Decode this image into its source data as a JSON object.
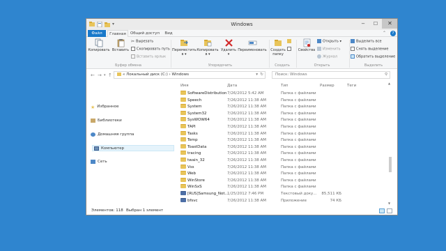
{
  "window": {
    "title": "Windows"
  },
  "window_buttons": {
    "minimize": "‒",
    "maximize": "☐",
    "close": "✕"
  },
  "tabs": [
    {
      "label": "Файл"
    },
    {
      "label": "Главная"
    },
    {
      "label": "Общий доступ"
    },
    {
      "label": "Вид"
    }
  ],
  "ribbon": {
    "clipboard": {
      "copy": "Копировать",
      "paste": "Вставить",
      "cut": "Вырезать",
      "copy_path": "Скопировать путь",
      "paste_shortcut": "Вставить ярлык",
      "label": "Буфер обмена"
    },
    "organize": {
      "move_to": "Переместить в ▾",
      "copy_to": "Копировать в ▾",
      "delete": "Удалить ▾",
      "rename": "Переименовать",
      "label": "Упорядочить"
    },
    "new": {
      "new_folder": "Создать папку",
      "label": "Создать"
    },
    "open": {
      "properties": "Свойства",
      "open": "Открыть ▾",
      "edit": "Изменить",
      "history": "Журнал",
      "label": "Открыть"
    },
    "select": {
      "select_all": "Выделить все",
      "select_none": "Снять выделение",
      "invert": "Обратить выделение",
      "label": "Выделить"
    }
  },
  "address": {
    "back": "←",
    "forward": "→",
    "up": "↑",
    "path": "«  Локальный диск (C:)  ›  Windows",
    "search_placeholder": "Поиск: Windows"
  },
  "nav": [
    {
      "label": "Избранное",
      "icon": "star-icon"
    },
    {
      "label": "Библиотеки",
      "icon": "library-icon"
    },
    {
      "label": "Домашняя группа",
      "icon": "homegroup-icon"
    },
    {
      "label": "Компьютер",
      "icon": "computer-icon"
    },
    {
      "label": "Сеть",
      "icon": "network-icon"
    }
  ],
  "columns": {
    "name": "Имя",
    "date": "Дата",
    "type": "Тип",
    "size": "Размер",
    "tags": "Теги"
  },
  "files": [
    {
      "name": "SoftwareDistribution",
      "date": "7/26/2012 5:42 AM",
      "type": "Папка с файлами",
      "size": "",
      "icon": "folder"
    },
    {
      "name": "Speech",
      "date": "7/26/2012 11:38 AM",
      "type": "Папка с файлами",
      "size": "",
      "icon": "folder"
    },
    {
      "name": "System",
      "date": "7/26/2012 11:38 AM",
      "type": "Папка с файлами",
      "size": "",
      "icon": "folder"
    },
    {
      "name": "System32",
      "date": "7/26/2012 11:38 AM",
      "type": "Папка с файлами",
      "size": "",
      "icon": "folder"
    },
    {
      "name": "SysWOW64",
      "date": "7/26/2012 11:38 AM",
      "type": "Папка с файлами",
      "size": "",
      "icon": "folder"
    },
    {
      "name": "TAPI",
      "date": "7/26/2012 11:38 AM",
      "type": "Папка с файлами",
      "size": "",
      "icon": "folder"
    },
    {
      "name": "Tasks",
      "date": "7/26/2012 11:38 AM",
      "type": "Папка с файлами",
      "size": "",
      "icon": "folder"
    },
    {
      "name": "Temp",
      "date": "7/26/2012 11:38 AM",
      "type": "Папка с файлами",
      "size": "",
      "icon": "folder"
    },
    {
      "name": "ToastData",
      "date": "7/26/2012 11:38 AM",
      "type": "Папка с файлами",
      "size": "",
      "icon": "folder"
    },
    {
      "name": "tracing",
      "date": "7/26/2012 11:38 AM",
      "type": "Папка с файлами",
      "size": "",
      "icon": "folder"
    },
    {
      "name": "twain_32",
      "date": "7/26/2012 11:38 AM",
      "type": "Папка с файлами",
      "size": "",
      "icon": "folder"
    },
    {
      "name": "Vss",
      "date": "7/26/2012 11:38 AM",
      "type": "Папка с файлами",
      "size": "",
      "icon": "folder"
    },
    {
      "name": "Web",
      "date": "7/26/2012 11:38 AM",
      "type": "Папка с файлами",
      "size": "",
      "icon": "folder"
    },
    {
      "name": "WinStore",
      "date": "7/26/2012 11:38 AM",
      "type": "Папка с файлами",
      "size": "",
      "icon": "folder"
    },
    {
      "name": "WinSxS",
      "date": "7/26/2012 11:38 AM",
      "type": "Папка с файлами",
      "size": "",
      "icon": "folder"
    },
    {
      "name": "[RUS]Samsung_Not...",
      "date": "1/25/2012 7:46 PM",
      "type": "Текстовый доку...",
      "size": "85,511 КБ",
      "icon": "file"
    },
    {
      "name": "bfsvc",
      "date": "7/26/2012 11:38 AM",
      "type": "Приложение",
      "size": "74 КБ",
      "icon": "file"
    }
  ],
  "status": {
    "count": "Элементов: 118",
    "selected": "Выбран 1 элемент"
  }
}
